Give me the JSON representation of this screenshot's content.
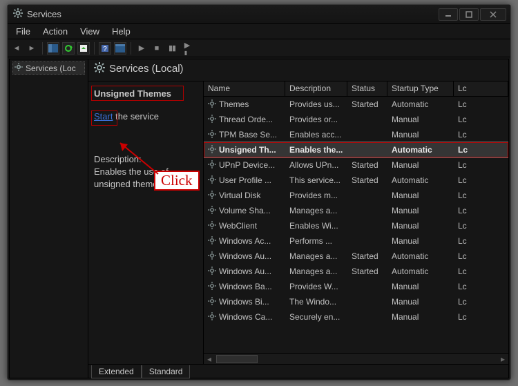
{
  "window": {
    "title": "Services"
  },
  "menu": {
    "file": "File",
    "action": "Action",
    "view": "View",
    "help": "Help"
  },
  "tree": {
    "root": "Services (Loc"
  },
  "header": {
    "title": "Services (Local)"
  },
  "details": {
    "heading": "Unsigned Themes",
    "start_link": "Start",
    "start_rest": " the service",
    "desc_label": "Description:",
    "desc_text": "Enables the use of unsigned themes."
  },
  "columns": {
    "name": "Name",
    "desc": "Description",
    "status": "Status",
    "startup": "Startup Type",
    "log": "Lc"
  },
  "rows": [
    {
      "name": "Themes",
      "desc": "Provides us...",
      "status": "Started",
      "startup": "Automatic",
      "log": "Lc",
      "sel": false
    },
    {
      "name": "Thread Orde...",
      "desc": "Provides or...",
      "status": "",
      "startup": "Manual",
      "log": "Lc",
      "sel": false
    },
    {
      "name": "TPM Base Se...",
      "desc": "Enables acc...",
      "status": "",
      "startup": "Manual",
      "log": "Lc",
      "sel": false
    },
    {
      "name": "Unsigned Th...",
      "desc": "Enables the...",
      "status": "",
      "startup": "Automatic",
      "log": "Lc",
      "sel": true
    },
    {
      "name": "UPnP Device...",
      "desc": "Allows UPn...",
      "status": "Started",
      "startup": "Manual",
      "log": "Lc",
      "sel": false
    },
    {
      "name": "User Profile ...",
      "desc": "This service...",
      "status": "Started",
      "startup": "Automatic",
      "log": "Lc",
      "sel": false
    },
    {
      "name": "Virtual Disk",
      "desc": "Provides m...",
      "status": "",
      "startup": "Manual",
      "log": "Lc",
      "sel": false
    },
    {
      "name": "Volume Sha...",
      "desc": "Manages a...",
      "status": "",
      "startup": "Manual",
      "log": "Lc",
      "sel": false
    },
    {
      "name": "WebClient",
      "desc": "Enables Wi...",
      "status": "",
      "startup": "Manual",
      "log": "Lc",
      "sel": false
    },
    {
      "name": "Windows Ac...",
      "desc": "Performs ...",
      "status": "",
      "startup": "Manual",
      "log": "Lc",
      "sel": false
    },
    {
      "name": "Windows Au...",
      "desc": "Manages a...",
      "status": "Started",
      "startup": "Automatic",
      "log": "Lc",
      "sel": false
    },
    {
      "name": "Windows Au...",
      "desc": "Manages a...",
      "status": "Started",
      "startup": "Automatic",
      "log": "Lc",
      "sel": false
    },
    {
      "name": "Windows Ba...",
      "desc": "Provides W...",
      "status": "",
      "startup": "Manual",
      "log": "Lc",
      "sel": false
    },
    {
      "name": "Windows Bi...",
      "desc": "The Windo...",
      "status": "",
      "startup": "Manual",
      "log": "Lc",
      "sel": false
    },
    {
      "name": "Windows Ca...",
      "desc": "Securely en...",
      "status": "",
      "startup": "Manual",
      "log": "Lc",
      "sel": false
    }
  ],
  "tabs": {
    "extended": "Extended",
    "standard": "Standard"
  },
  "annotation": {
    "click": "Click"
  }
}
